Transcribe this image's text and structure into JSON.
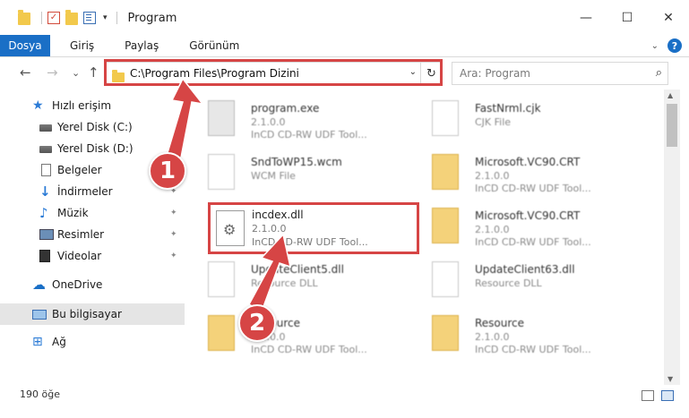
{
  "window": {
    "title": "Program",
    "controls": {
      "minimize": "—",
      "maximize": "☐",
      "close": "✕"
    }
  },
  "quick_access_caret": "▾",
  "ribbon": {
    "file_tab": "Dosya",
    "tabs": [
      "Giriş",
      "Paylaş",
      "Görünüm"
    ],
    "expand": "⌄",
    "help": "?"
  },
  "navigation": {
    "back": "←",
    "forward": "→",
    "recent": "⌄",
    "up": "↑",
    "address": "C:\\Program Files\\Program Dizini",
    "address_caret": "⌄",
    "refresh": "↻",
    "search_placeholder": "Ara: Program",
    "search_icon": "⌕"
  },
  "sidebar": {
    "items": [
      {
        "label": "Hızlı erişim",
        "icon": "star-icon",
        "glyph": "★"
      },
      {
        "label": "Yerel Disk (C:)",
        "icon": "drive-icon"
      },
      {
        "label": "Yerel Disk (D:)",
        "icon": "drive-icon"
      },
      {
        "label": "Belgeler",
        "icon": "document-icon"
      },
      {
        "label": "İndirmeler",
        "icon": "download-icon",
        "glyph": "↓"
      },
      {
        "label": "Müzik",
        "icon": "music-icon",
        "glyph": "♪"
      },
      {
        "label": "Resimler",
        "icon": "pictures-icon"
      },
      {
        "label": "Videolar",
        "icon": "video-icon"
      },
      {
        "label": "OneDrive",
        "icon": "cloud-icon",
        "glyph": "☁"
      },
      {
        "label": "Bu bilgisayar",
        "icon": "computer-icon"
      },
      {
        "label": "Ağ",
        "icon": "network-icon",
        "glyph": "⊞"
      }
    ],
    "pin": "✦"
  },
  "files": [
    {
      "name": "program.exe",
      "line2": "2.1.0.0",
      "line3": "InCD CD-RW UDF Tool..."
    },
    {
      "name": "FastNrml.cjk",
      "line2": "CJK File",
      "line3": ""
    },
    {
      "name": "SndToWP15.wcm",
      "line2": "WCM File",
      "line3": ""
    },
    {
      "name": "Microsoft.VC90.CRT",
      "line2": "2.1.0.0",
      "line3": "InCD CD-RW UDF Tool..."
    },
    {
      "name": "Microsoft.VC90.CRT",
      "line2": "2.1.0.0",
      "line3": "InCD CD-RW UDF Tool..."
    },
    {
      "name": "UpdateClient5.dll",
      "line2": "Resource DLL",
      "line3": ""
    },
    {
      "name": "UpdateClient63.dll",
      "line2": "Resource DLL",
      "line3": ""
    },
    {
      "name": "Resource",
      "line2": "2.1.0.0",
      "line3": "InCD CD-RW UDF Tool..."
    },
    {
      "name": "Resource",
      "line2": "2.1.0.0",
      "line3": "InCD CD-RW UDF Tool..."
    }
  ],
  "highlighted_file": {
    "name": "incdex.dll",
    "line2": "2.1.0.0",
    "line3": "InCD CD-RW UDF Tool...",
    "icon": "gear-icon",
    "glyph": "⚙"
  },
  "scrollbar": {
    "up": "▲",
    "down": "▼"
  },
  "status": {
    "count": "190 öğe"
  },
  "callouts": [
    "1",
    "2"
  ],
  "colors": {
    "accent": "#1a6fc6",
    "annotation": "#d64545"
  }
}
